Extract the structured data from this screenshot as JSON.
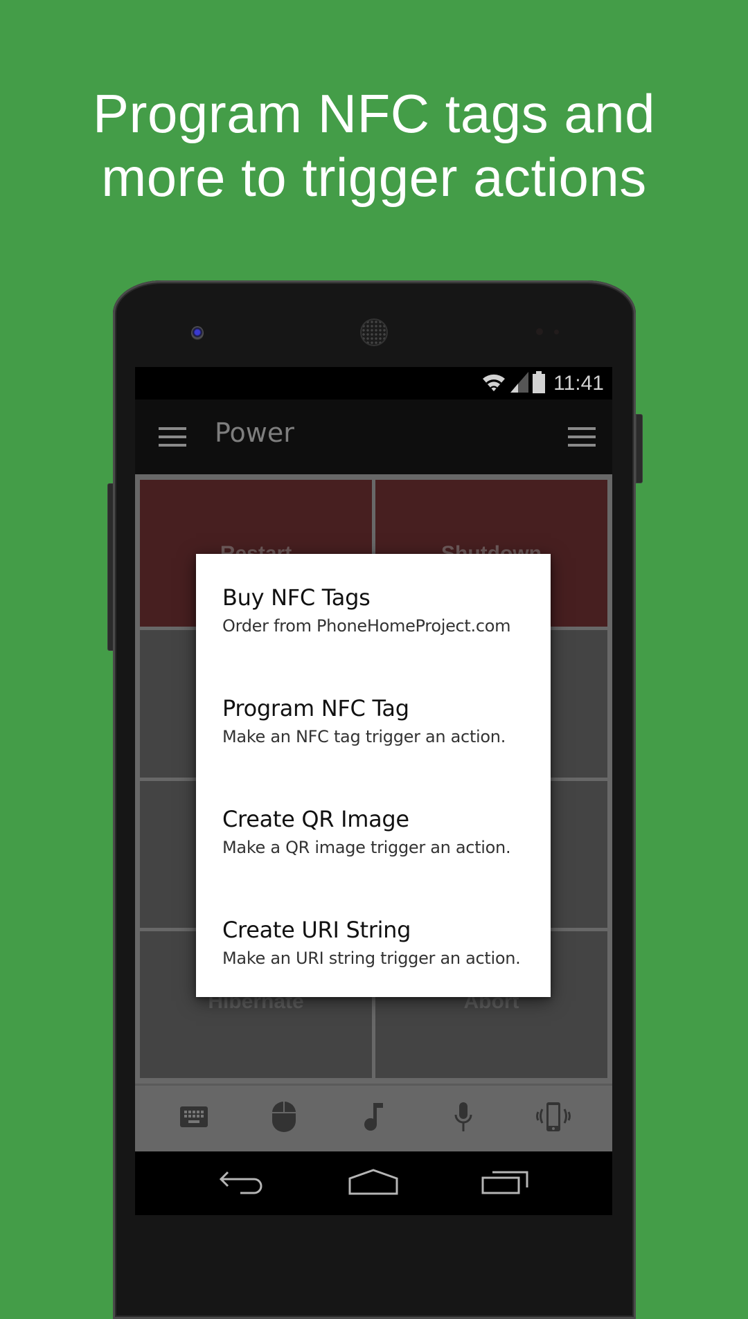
{
  "promo": {
    "headline_line1": "Program NFC tags and",
    "headline_line2": "more to trigger actions",
    "background_color": "#449d48"
  },
  "status_bar": {
    "icons": [
      "wifi-icon",
      "cell-signal-icon",
      "battery-icon"
    ],
    "time": "11:41"
  },
  "app_bar": {
    "nav_icon": "hamburger-menu-icon",
    "title": "Power",
    "overflow_icon": "hamburger-menu-icon"
  },
  "grid": {
    "tiles": [
      {
        "label": "Restart",
        "style": "red"
      },
      {
        "label": "Shutdown",
        "style": "red"
      },
      {
        "label": "",
        "style": "gray"
      },
      {
        "label": "",
        "style": "gray"
      },
      {
        "label": "",
        "style": "gray"
      },
      {
        "label": "",
        "style": "gray"
      },
      {
        "label": "Hibernate",
        "style": "gray"
      },
      {
        "label": "Abort",
        "style": "gray"
      }
    ]
  },
  "toolbar": {
    "items": [
      {
        "icon": "keyboard-icon"
      },
      {
        "icon": "mouse-icon"
      },
      {
        "icon": "music-note-icon"
      },
      {
        "icon": "microphone-icon"
      },
      {
        "icon": "phone-vibrate-icon"
      }
    ]
  },
  "nav_bar": {
    "items": [
      {
        "icon": "back-icon"
      },
      {
        "icon": "home-icon"
      },
      {
        "icon": "recents-icon"
      }
    ]
  },
  "dialog": {
    "items": [
      {
        "title": "Buy NFC Tags",
        "subtitle": "Order from PhoneHomeProject.com"
      },
      {
        "title": "Program NFC Tag",
        "subtitle": "Make an NFC tag trigger an action."
      },
      {
        "title": "Create QR Image",
        "subtitle": "Make a QR image trigger an action."
      },
      {
        "title": "Create URI String",
        "subtitle": "Make an URI string trigger an action."
      }
    ]
  }
}
